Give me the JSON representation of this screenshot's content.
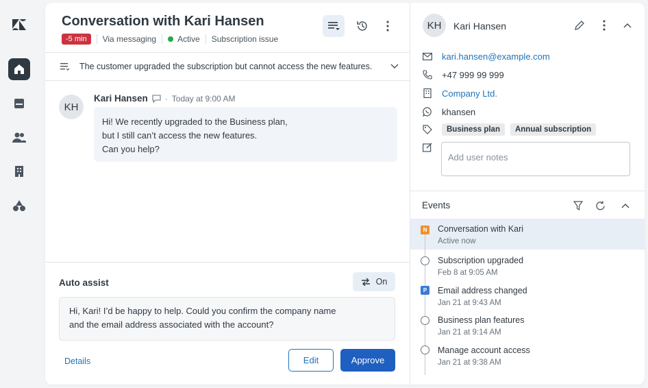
{
  "app": {
    "brand_color": "#2f3941",
    "accent": "#1f73b7"
  },
  "nav": {
    "items": [
      {
        "icon": "zendesk-logo-icon"
      },
      {
        "icon": "home-icon",
        "active": true
      },
      {
        "icon": "inbox-icon"
      },
      {
        "icon": "users-icon"
      },
      {
        "icon": "building-icon"
      },
      {
        "icon": "shapes-icon"
      }
    ]
  },
  "conversation": {
    "title": "Conversation with Kari Hansen",
    "sla_badge": "-5 min",
    "channel": "Via messaging",
    "status": "Active",
    "topic": "Subscription issue",
    "summary": "The customer upgraded the subscription but cannot access the new features.",
    "message": {
      "initials": "KH",
      "author": "Kari Hansen",
      "time": "Today at 9:00 AM",
      "lines": [
        "Hi! We recently upgraded to the Business plan,",
        "but I still can’t access the new features.",
        "Can you help?"
      ]
    }
  },
  "auto_assist": {
    "title": "Auto assist",
    "toggle_label": "On",
    "suggestion_lines": [
      "Hi, Kari! I’d be happy to help. Could you confirm the company name",
      "and the email address associated with the account?"
    ],
    "details_label": "Details",
    "edit_label": "Edit",
    "approve_label": "Approve"
  },
  "customer": {
    "initials": "KH",
    "name": "Kari Hansen",
    "email": "kari.hansen@example.com",
    "phone": "+47 999 99 999",
    "company": "Company Ltd.",
    "whatsapp": "khansen",
    "tags": [
      "Business plan",
      "Annual subscription"
    ],
    "notes_placeholder": "Add user notes"
  },
  "events": {
    "title": "Events",
    "items": [
      {
        "title": "Conversation with Kari",
        "sub": "Active now",
        "marker": "N",
        "color": "#f0902f"
      },
      {
        "title": "Subscription upgraded",
        "sub": "Feb 8 at 9:05 AM",
        "marker": "circle"
      },
      {
        "title": "Email address changed",
        "sub": "Jan 21 at 9:43 AM",
        "marker": "P",
        "color": "#3a7bd5"
      },
      {
        "title": "Business plan features",
        "sub": "Jan 21 at 9:14 AM",
        "marker": "circle"
      },
      {
        "title": "Manage account access",
        "sub": "Jan 21 at 9:38 AM",
        "marker": "circle"
      }
    ]
  }
}
